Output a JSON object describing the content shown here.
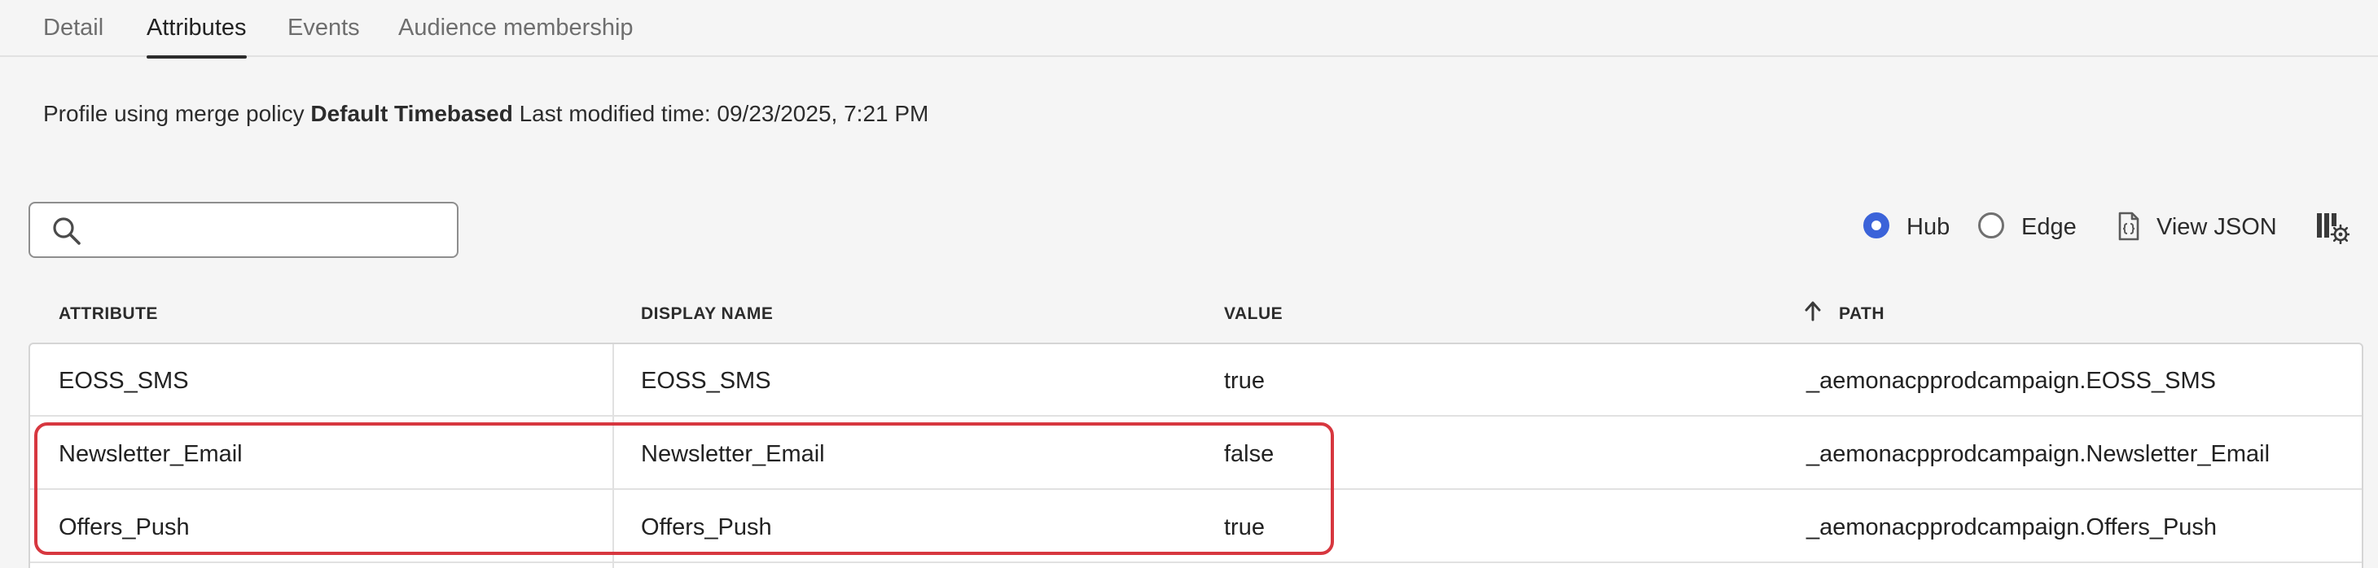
{
  "tabs": [
    {
      "label": "Detail"
    },
    {
      "label": "Attributes"
    },
    {
      "label": "Events"
    },
    {
      "label": "Audience membership"
    }
  ],
  "policy": {
    "prefix": "Profile using merge policy",
    "policy_name": "Default Timebased",
    "modified_label": "Last modified time:",
    "modified_time": "09/23/2025, 7:21 PM"
  },
  "search": {
    "value": "",
    "placeholder": ""
  },
  "toolbar": {
    "hub_label": "Hub",
    "edge_label": "Edge",
    "view_json_label": "View JSON",
    "selected_source": "Hub"
  },
  "table": {
    "columns": [
      "ATTRIBUTE",
      "DISPLAY NAME",
      "VALUE",
      "PATH"
    ],
    "sort_column": "PATH",
    "sort_direction": "ascending",
    "rows": [
      {
        "attribute": "EOSS_SMS",
        "display_name": "EOSS_SMS",
        "value": "true",
        "path": "_aemonacpprodcampaign.EOSS_SMS"
      },
      {
        "attribute": "Newsletter_Email",
        "display_name": "Newsletter_Email",
        "value": "false",
        "path": "_aemonacpprodcampaign.Newsletter_Email"
      },
      {
        "attribute": "Offers_Push",
        "display_name": "Offers_Push",
        "value": "true",
        "path": "_aemonacpprodcampaign.Offers_Push"
      }
    ]
  },
  "colors": {
    "radio_selected": "#3b63d9",
    "highlight_border": "#d7373f"
  }
}
